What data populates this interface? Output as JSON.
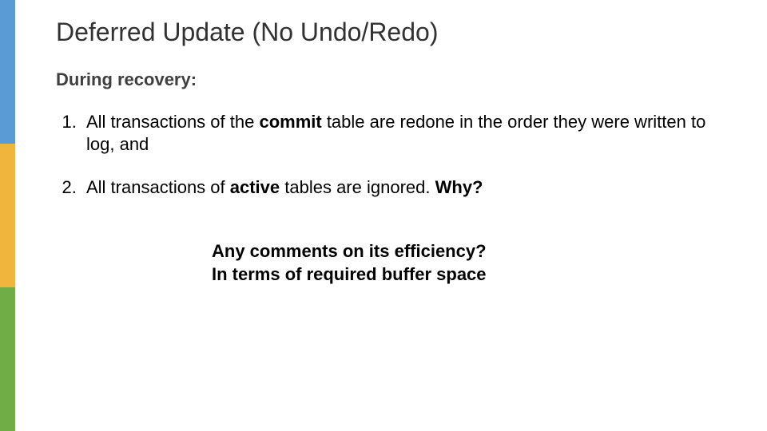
{
  "title": "Deferred Update (No Undo/Redo)",
  "subhead": "During recovery:",
  "points": {
    "p1_a": "All transactions of the ",
    "p1_b": "commit",
    "p1_c": " table are redone in the order they were written to log, and",
    "p2_a": "All transactions of ",
    "p2_b": "active",
    "p2_c": " tables are ignored. ",
    "p2_d": "Why?"
  },
  "callout": {
    "line1": "Any comments on its efficiency?",
    "line2": "In terms of required buffer space"
  }
}
